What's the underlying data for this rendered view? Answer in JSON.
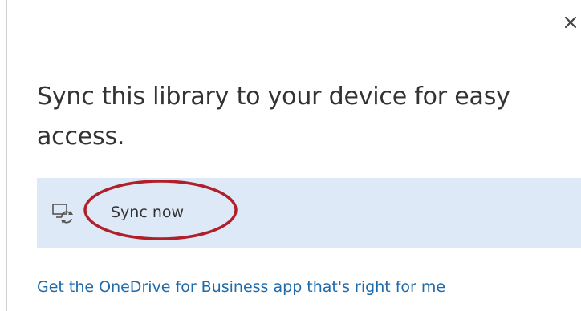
{
  "dialog": {
    "close_label": "×",
    "heading": "Sync this library to your device for easy access.",
    "sync_button": {
      "label": "Sync now",
      "icon": "sync-device-icon"
    },
    "app_link": "Get the OneDrive for Business app that's right for me"
  },
  "colors": {
    "sync_bar_background": "#dde9f6",
    "link": "#1f6aa9",
    "annotation_ellipse": "#b0202a",
    "text": "#333333"
  }
}
